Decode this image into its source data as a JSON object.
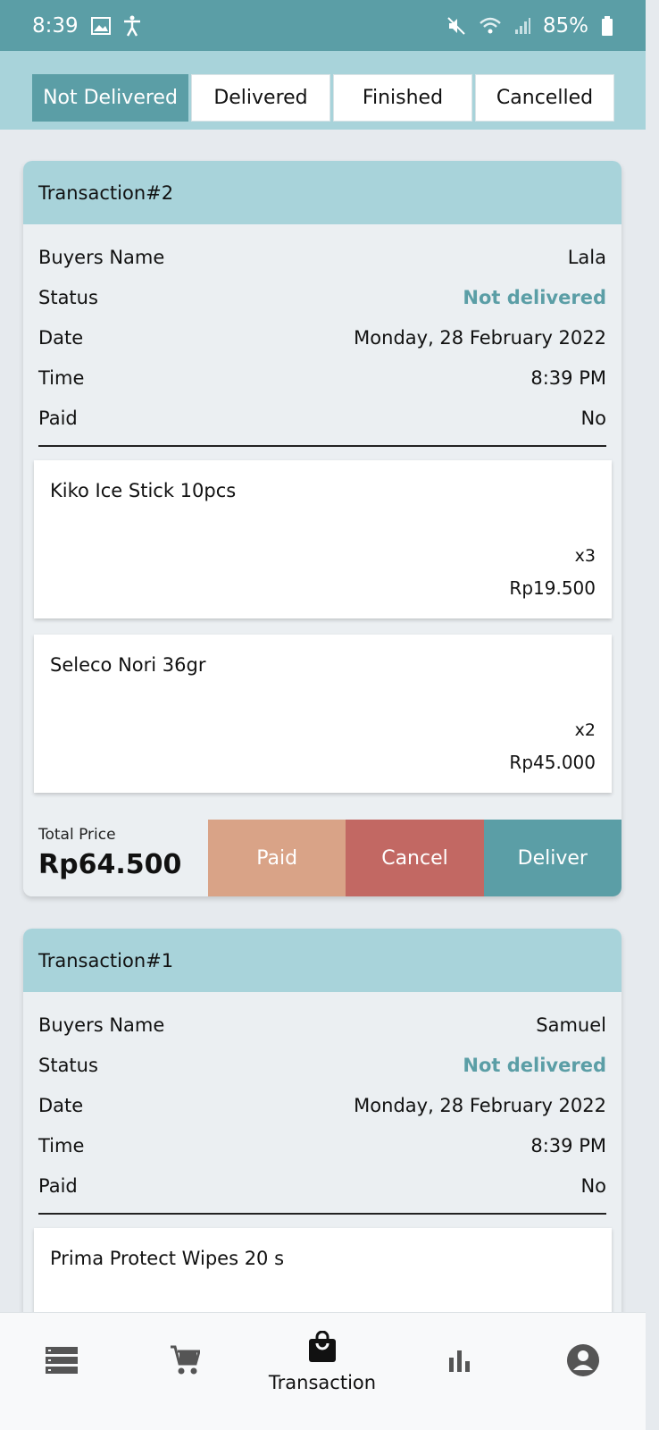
{
  "status_bar": {
    "time": "8:39",
    "battery": "85%",
    "icons_left": [
      "image-icon",
      "accessibility-icon"
    ],
    "icons_right": [
      "mute-icon",
      "wifi-icon",
      "signal-icon",
      "battery-icon"
    ]
  },
  "tabs": [
    {
      "label": "Not Delivered",
      "active": true
    },
    {
      "label": "Delivered",
      "active": false
    },
    {
      "label": "Finished",
      "active": false
    },
    {
      "label": "Cancelled",
      "active": false
    }
  ],
  "labels": {
    "buyers_name": "Buyers Name",
    "status": "Status",
    "date": "Date",
    "time": "Time",
    "paid": "Paid",
    "total_price": "Total Price",
    "paid_button": "Paid",
    "cancel_button": "Cancel",
    "deliver_button": "Deliver"
  },
  "transactions": [
    {
      "title": "Transaction#2",
      "buyer": "Lala",
      "status": "Not delivered",
      "date": "Monday, 28 February 2022",
      "time": "8:39 PM",
      "paid": "No",
      "items": [
        {
          "name": "Kiko Ice Stick 10pcs",
          "qty": "x3",
          "price": "Rp19.500"
        },
        {
          "name": "Seleco Nori 36gr",
          "qty": "x2",
          "price": "Rp45.000"
        }
      ],
      "total": "Rp64.500"
    },
    {
      "title": "Transaction#1",
      "buyer": "Samuel",
      "status": "Not delivered",
      "date": "Monday, 28 February 2022",
      "time": "8:39 PM",
      "paid": "No",
      "items": [
        {
          "name": "Prima Protect Wipes 20 s"
        }
      ]
    }
  ],
  "bottom_nav": [
    {
      "icon": "list-icon",
      "label": ""
    },
    {
      "icon": "cart-icon",
      "label": ""
    },
    {
      "icon": "shopping-bag-icon",
      "label": "Transaction",
      "active": true
    },
    {
      "icon": "bar-chart-icon",
      "label": ""
    },
    {
      "icon": "account-icon",
      "label": ""
    }
  ],
  "colors": {
    "primary": "#5b9ea6",
    "header_light": "#a8d3da",
    "paid": "#d9a387",
    "cancel": "#c26863",
    "background": "#e6eaee"
  }
}
